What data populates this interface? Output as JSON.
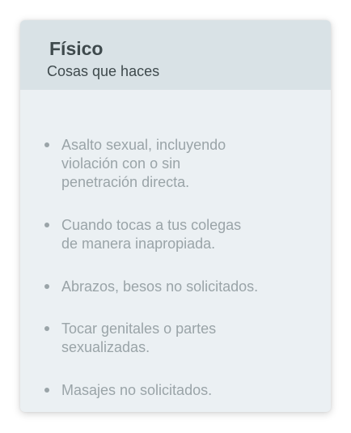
{
  "card": {
    "title": "Físico",
    "subtitle": "Cosas que haces",
    "items": [
      {
        "line1": "Asalto sexual, incluyendo",
        "line2": "violación con o sin",
        "line3": "penetración directa."
      },
      {
        "line1": "Cuando tocas a tus colegas",
        "line2": "de manera inapropiada."
      },
      {
        "line1": "Abrazos, besos no solicitados."
      },
      {
        "line1": "Tocar genitales o partes",
        "line2": "sexualizadas."
      },
      {
        "line1": "Masajes no solicitados."
      }
    ],
    "colors": {
      "header_bg": "#d9e2e6",
      "body_bg": "#ebf0f3",
      "title_text": "#3f4a4d",
      "item_text": "#9aa4a8"
    },
    "icons": {
      "bullet": "bullet-dot-icon"
    }
  }
}
